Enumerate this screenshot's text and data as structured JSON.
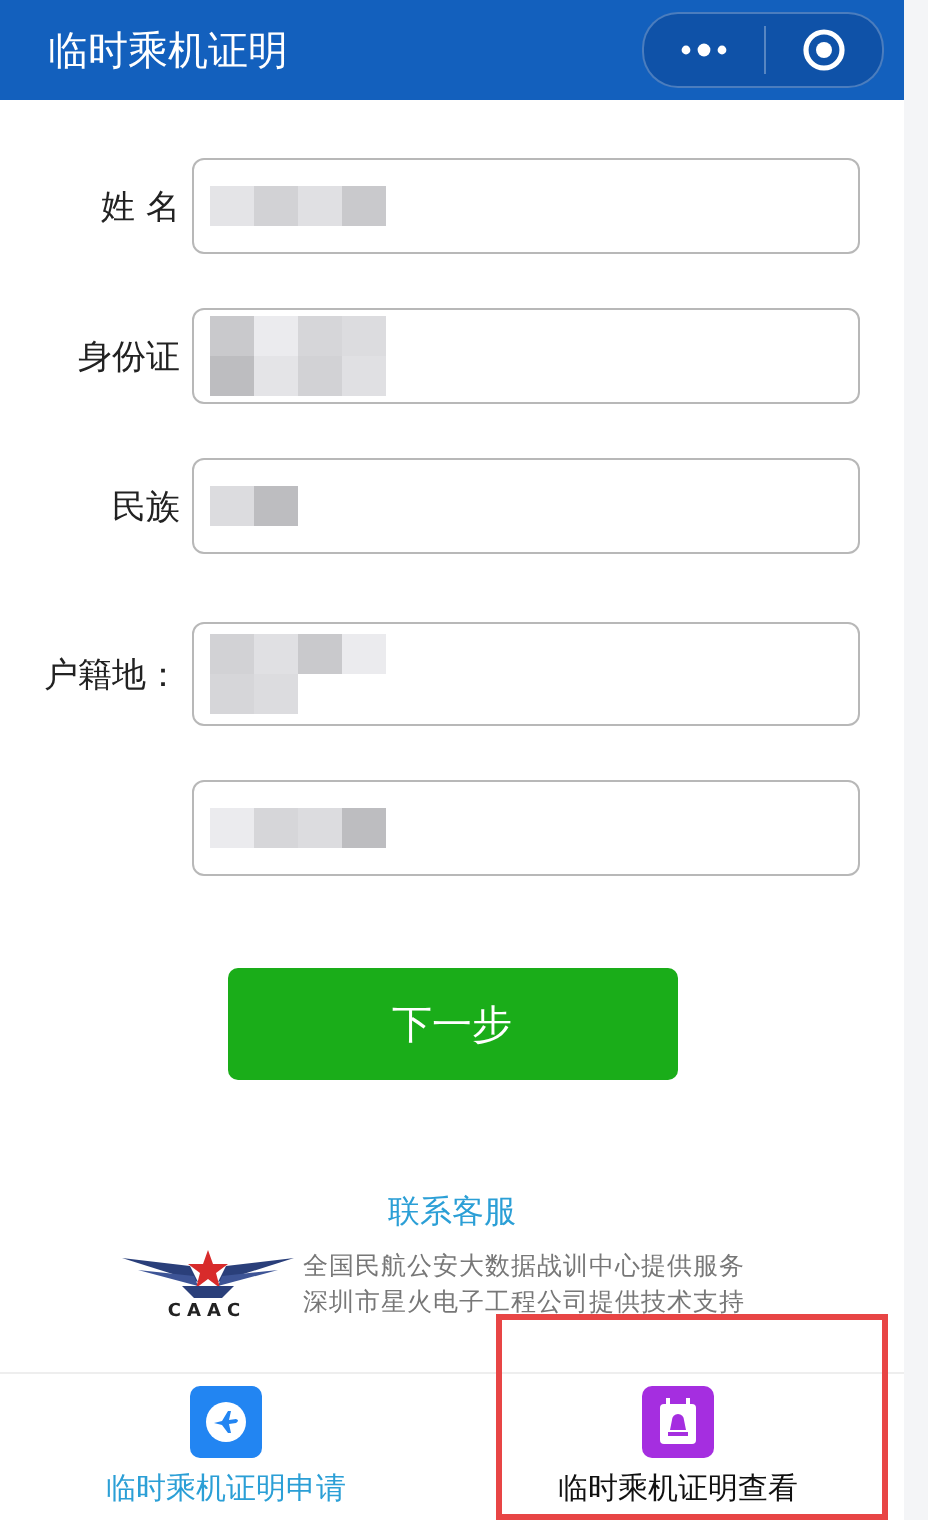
{
  "header": {
    "title": "临时乘机证明"
  },
  "form": {
    "fields": [
      {
        "label": "姓 名",
        "redacted": true
      },
      {
        "label": "身份证",
        "redacted": true
      },
      {
        "label": "民族",
        "redacted": true
      },
      {
        "label": "户籍地：",
        "redacted": true
      },
      {
        "redacted": true
      }
    ]
  },
  "next_button": "下一步",
  "footer": {
    "contact_link": "联系客服",
    "logo_text": "CAAC",
    "credits": [
      "全国民航公安大数据战训中心提供服务",
      "深圳市星火电子工程公司提供技术支持"
    ]
  },
  "tabs": [
    {
      "label": "临时乘机证明申请",
      "kind": "plane",
      "selected": true,
      "highlighted": false
    },
    {
      "label": "临时乘机证明查看",
      "kind": "certificate",
      "selected": false,
      "highlighted": true
    }
  ]
}
